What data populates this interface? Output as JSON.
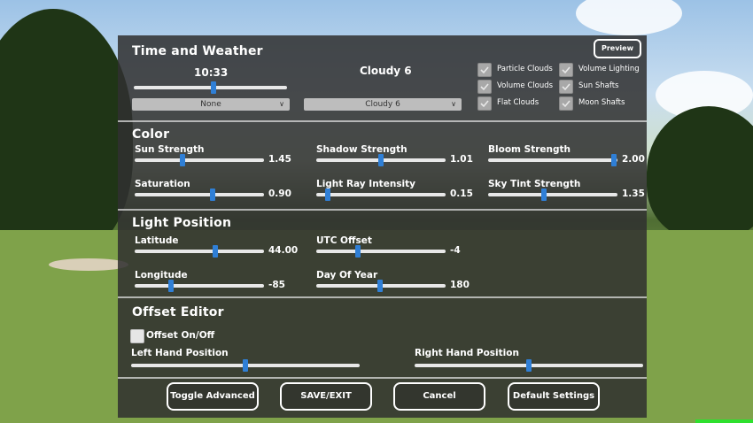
{
  "time_weather": {
    "title": "Time and Weather",
    "preview_label": "Preview",
    "time_value": "10:33",
    "time_slider_fraction": 0.52,
    "preset_title": "Cloudy 6",
    "dropdown_left": "None",
    "dropdown_right": "Cloudy 6",
    "checkboxes": [
      {
        "label": "Particle Clouds",
        "checked": true
      },
      {
        "label": "Volume Lighting",
        "checked": true
      },
      {
        "label": "Volume Clouds",
        "checked": true
      },
      {
        "label": "Sun Shafts",
        "checked": true
      },
      {
        "label": "Flat Clouds",
        "checked": true
      },
      {
        "label": "Moon Shafts",
        "checked": true
      }
    ]
  },
  "color": {
    "title": "Color",
    "sliders": [
      {
        "label": "Sun Strength",
        "value": "1.45",
        "fraction": 0.37
      },
      {
        "label": "Shadow Strength",
        "value": "1.01",
        "fraction": 0.5
      },
      {
        "label": "Bloom Strength",
        "value": "2.00",
        "fraction": 0.97
      },
      {
        "label": "Saturation",
        "value": "0.90",
        "fraction": 0.6
      },
      {
        "label": "Light Ray Intensity",
        "value": "0.15",
        "fraction": 0.09
      },
      {
        "label": "Sky Tint Strength",
        "value": "1.35",
        "fraction": 0.43
      }
    ]
  },
  "light_position": {
    "title": "Light Position",
    "sliders": [
      {
        "label": "Latitude",
        "value": "44.00",
        "fraction": 0.62
      },
      {
        "label": "UTC Offset",
        "value": "-4",
        "fraction": 0.32
      },
      {
        "label": "Longitude",
        "value": "-85",
        "fraction": 0.28
      },
      {
        "label": "Day Of Year",
        "value": "180",
        "fraction": 0.49
      }
    ]
  },
  "offset_editor": {
    "title": "Offset Editor",
    "toggle_label": "Offset On/Off",
    "toggle_checked": false,
    "left_hand_label": "Left Hand Position",
    "left_hand_fraction": 0.5,
    "right_hand_label": "Right Hand Position",
    "right_hand_fraction": 0.5
  },
  "buttons": {
    "toggle_advanced": "Toggle Advanced",
    "save_exit": "SAVE/EXIT",
    "cancel": "Cancel",
    "default_settings": "Default Settings"
  }
}
